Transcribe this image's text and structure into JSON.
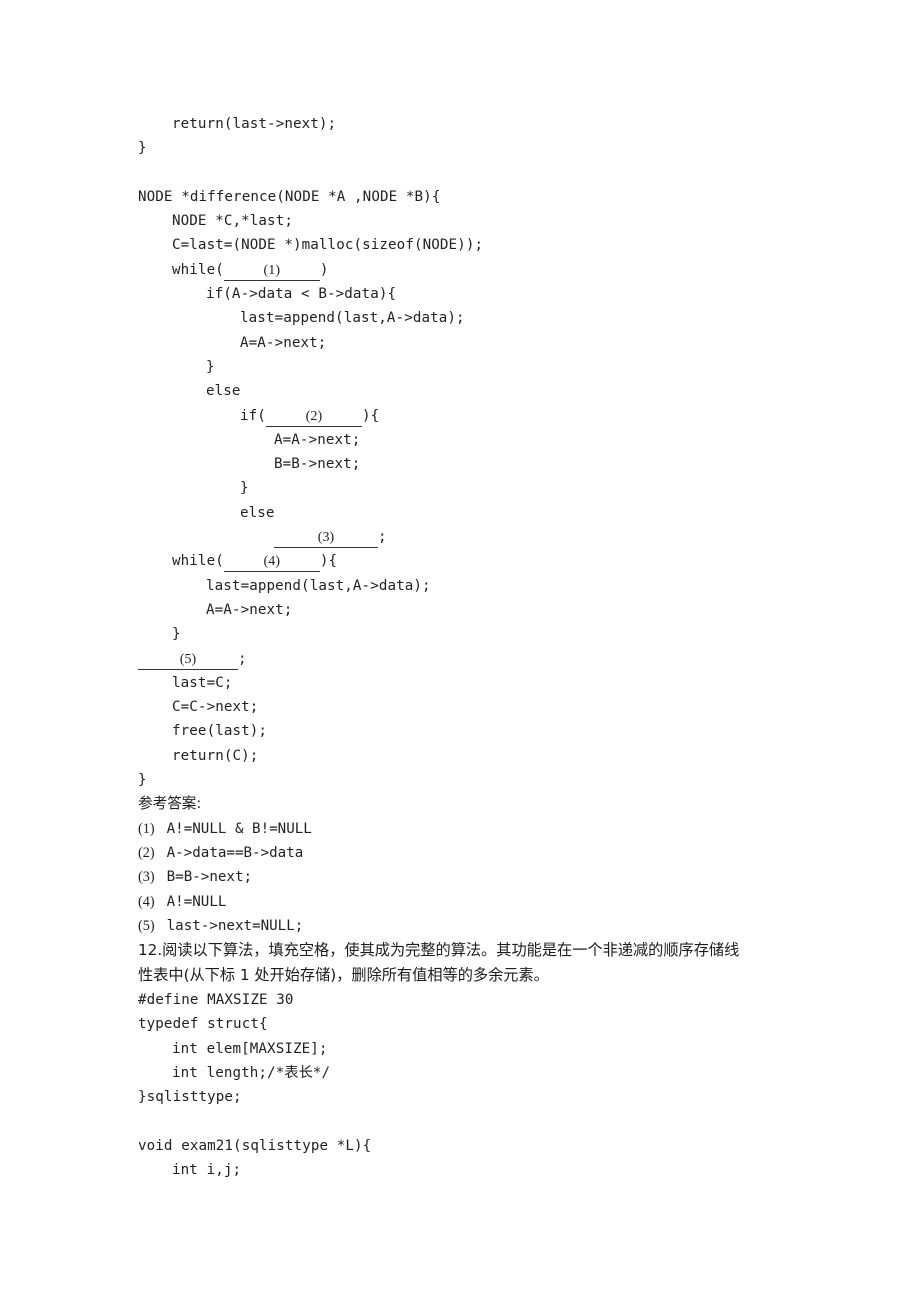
{
  "page": {
    "background_color": "#ffffff",
    "text_color": "#222222"
  },
  "code_block_1": {
    "name": "difference-function-code",
    "lines": [
      {
        "indent": 1,
        "text": "return(last->next);"
      },
      {
        "indent": 0,
        "text": "}"
      },
      {
        "indent": 0,
        "text": ""
      },
      {
        "indent": 0,
        "text": "NODE *difference(NODE *A ,NODE *B){"
      },
      {
        "indent": 1,
        "text": "NODE *C,*last;"
      },
      {
        "indent": 1,
        "text": "C=last=(NODE *)malloc(sizeof(NODE));"
      },
      {
        "indent": 1,
        "text": "while(",
        "blank": "(1)",
        "blank_width": "blank-w1",
        "text_after": ")"
      },
      {
        "indent": 2,
        "text": "if(A->data < B->data){"
      },
      {
        "indent": 3,
        "text": "last=append(last,A->data);"
      },
      {
        "indent": 3,
        "text": "A=A->next;"
      },
      {
        "indent": 2,
        "text": "}"
      },
      {
        "indent": 2,
        "text": "else"
      },
      {
        "indent": 3,
        "text": "if(",
        "blank": "(2)",
        "blank_width": "blank-w2",
        "text_after": "){"
      },
      {
        "indent": 4,
        "text": "A=A->next;"
      },
      {
        "indent": 4,
        "text": "B=B->next;"
      },
      {
        "indent": 3,
        "text": "}"
      },
      {
        "indent": 3,
        "text": "else"
      },
      {
        "indent": 4,
        "text": "",
        "blank": "(3)",
        "blank_width": "blank-w3",
        "text_after": ";"
      },
      {
        "indent": 1,
        "text": "while(",
        "blank": "(4)",
        "blank_width": "blank-w4",
        "text_after": "){"
      },
      {
        "indent": 2,
        "text": "last=append(last,A->data);"
      },
      {
        "indent": 2,
        "text": "A=A->next;"
      },
      {
        "indent": 1,
        "text": "}"
      },
      {
        "indent": 0,
        "text": "",
        "blank": "(5)",
        "blank_width": "blank-w5",
        "text_after": ";"
      },
      {
        "indent": 1,
        "text": "last=C;"
      },
      {
        "indent": 1,
        "text": "C=C->next;"
      },
      {
        "indent": 1,
        "text": "free(last);"
      },
      {
        "indent": 1,
        "text": "return(C);"
      },
      {
        "indent": 0,
        "text": "}"
      }
    ]
  },
  "answers": {
    "heading": "参考答案:",
    "items": [
      {
        "num": "(1)",
        "text": "A!=NULL & B!=NULL"
      },
      {
        "num": "(2)",
        "text": "A->data==B->data"
      },
      {
        "num": "(3)",
        "text": "B=B->next;"
      },
      {
        "num": "(4)",
        "text": "A!=NULL"
      },
      {
        "num": "(5)",
        "text": "last->next=NULL;"
      }
    ]
  },
  "question_12": {
    "line1": "12.阅读以下算法，填充空格，使其成为完整的算法。其功能是在一个非递减的顺序存储线",
    "line2": "性表中(从下标 1 处开始存储)，删除所有值相等的多余元素。"
  },
  "code_block_2": {
    "name": "exam21-function-code",
    "lines": [
      {
        "indent": 0,
        "text": "#define MAXSIZE 30"
      },
      {
        "indent": 0,
        "text": "typedef struct{"
      },
      {
        "indent": 1,
        "text": "int elem[MAXSIZE];"
      },
      {
        "indent": 1,
        "text": "int length;/*表长*/"
      },
      {
        "indent": 0,
        "text": "}sqlisttype;"
      },
      {
        "indent": 0,
        "text": ""
      },
      {
        "indent": 0,
        "text": "void exam21(sqlisttype *L){"
      },
      {
        "indent": 1,
        "text": "int i,j;"
      }
    ]
  }
}
